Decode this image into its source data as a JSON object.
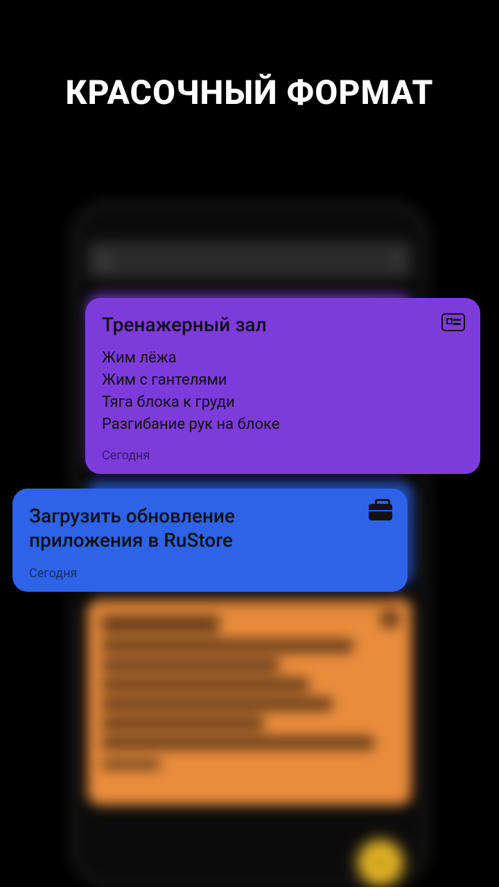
{
  "headline": "КРАСОЧНЫЙ ФОРМАТ",
  "cards": {
    "gym": {
      "title": "Тренажерный зал",
      "lines": [
        "Жим лёжа",
        "Жим с гантелями",
        "Тяга блока к груди",
        "Разгибание рук на блоке"
      ],
      "date": "Сегодня",
      "icon": "list-icon",
      "color": "#7d3bdc"
    },
    "upload": {
      "title": "Загрузить обновление приложения в  RuStore",
      "date": "Сегодня",
      "icon": "briefcase-icon",
      "color": "#2e63e7"
    }
  },
  "blurred_card": {
    "color": "#e98c3c"
  },
  "fab_color": "#f2c029"
}
